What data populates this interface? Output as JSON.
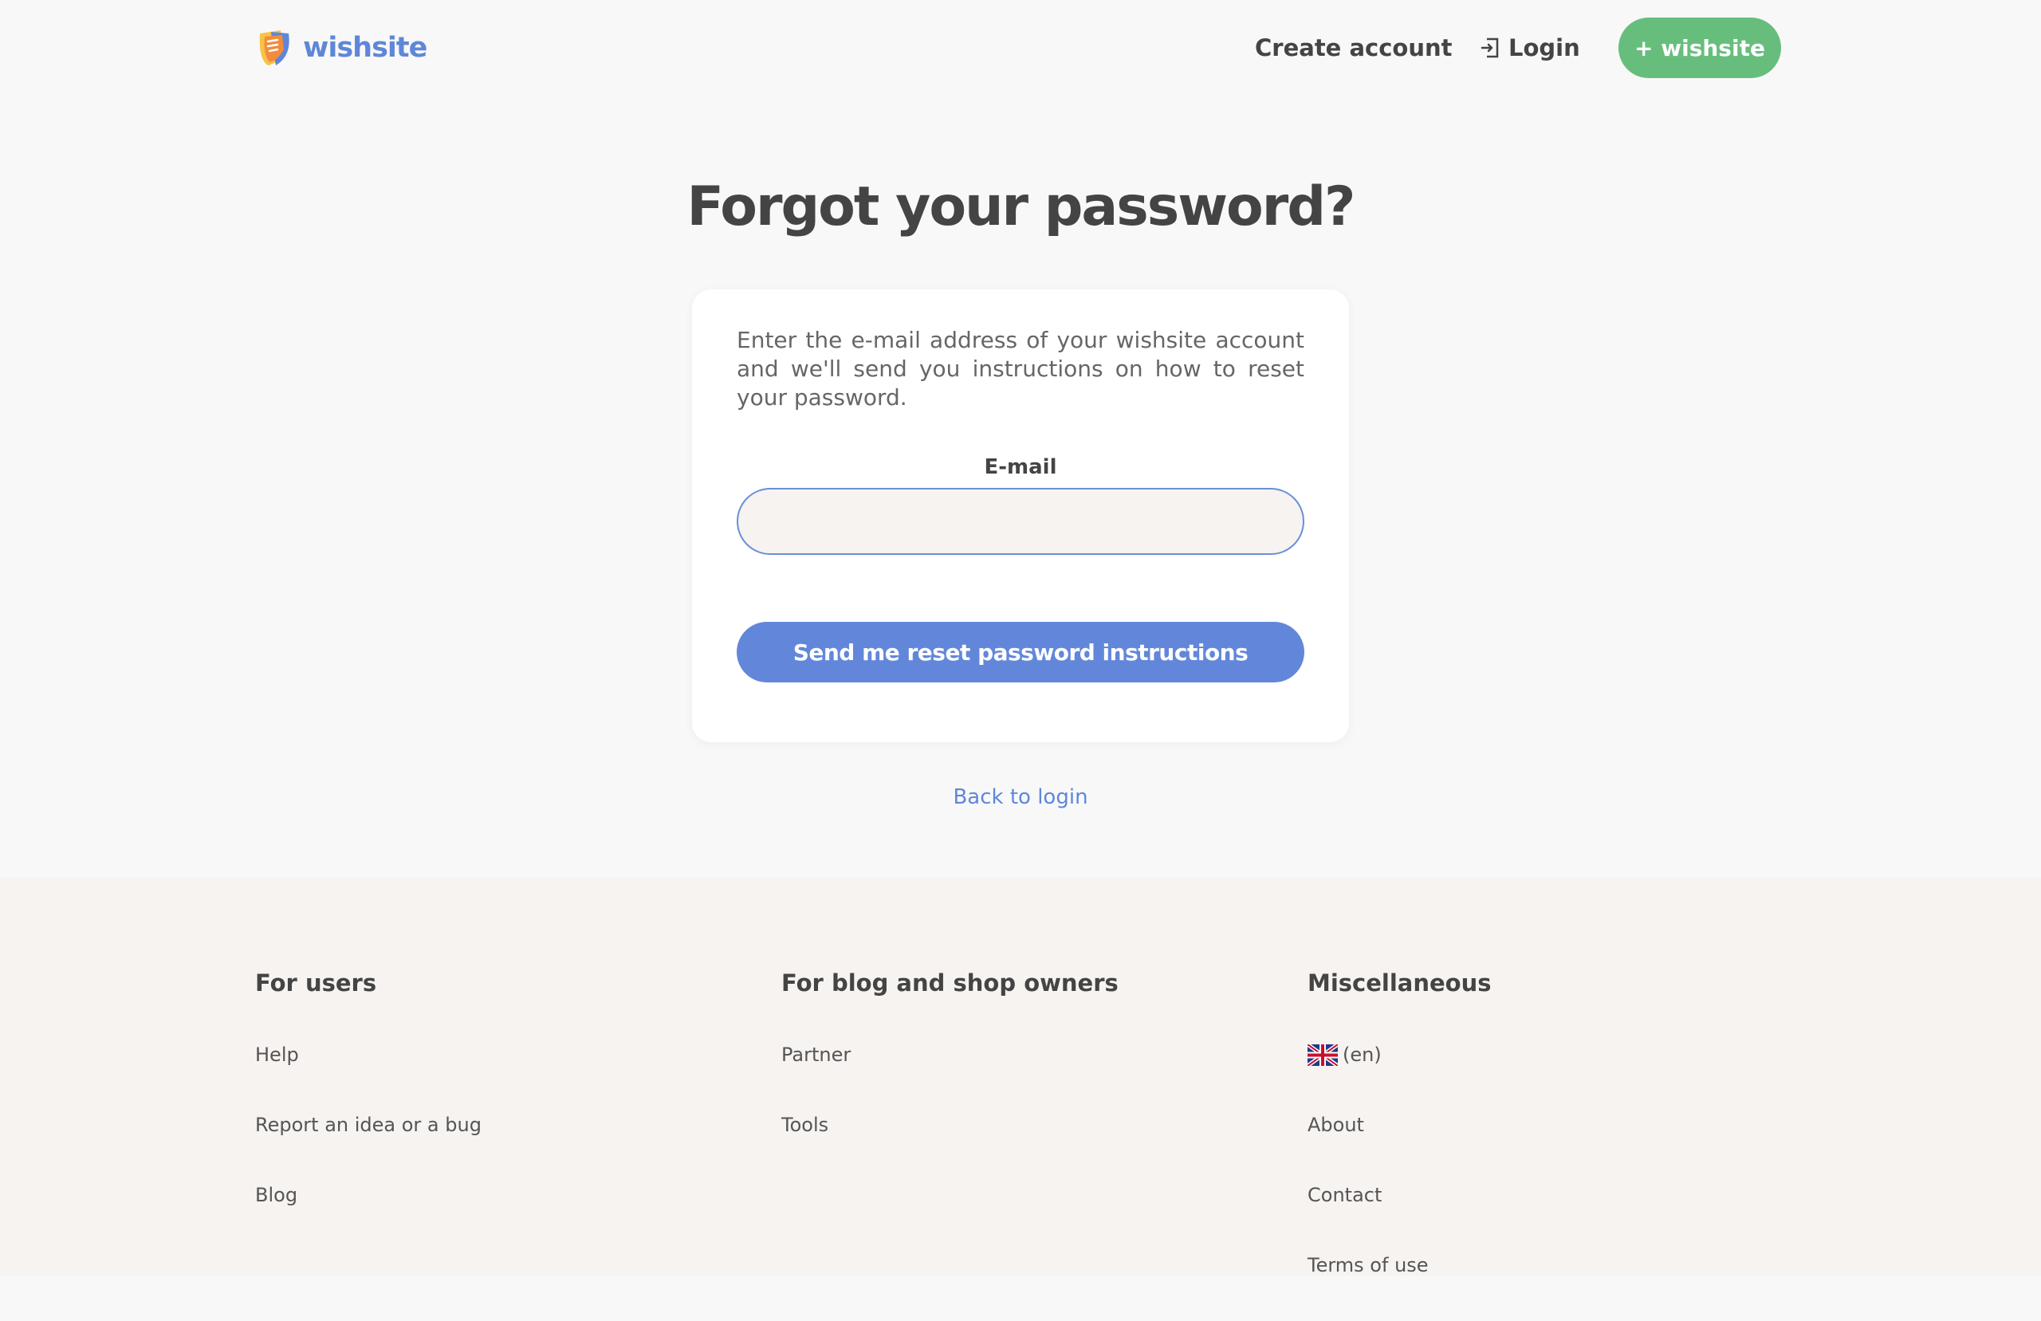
{
  "header": {
    "logo_text": "wishsite",
    "create_account": "Create account",
    "login": "Login",
    "cta": "+ wishsite"
  },
  "main": {
    "title": "Forgot your password?",
    "description": "Enter the e-mail address of your wishsite account and we'll send you instructions on how to reset your password.",
    "email_label": "E-mail",
    "email_value": "",
    "email_placeholder": "",
    "submit_label": "Send me reset password instructions",
    "back_link": "Back to login"
  },
  "footer": {
    "columns": [
      {
        "heading": "For users",
        "links": [
          "Help",
          "Report an idea or a bug",
          "Blog"
        ]
      },
      {
        "heading": "For blog and shop owners",
        "links": [
          "Partner",
          "Tools"
        ]
      },
      {
        "heading": "Miscellaneous",
        "language": "(en)",
        "links": [
          "About",
          "Contact",
          "Terms of use"
        ]
      }
    ]
  },
  "colors": {
    "brand_blue": "#5f87d8",
    "button_blue": "#6287da",
    "cta_green": "#67be7c",
    "footer_bg": "#f6f3f1"
  },
  "icons": {
    "logo": "wishsite-logo-icon",
    "login": "login-icon",
    "language": "uk-flag-icon"
  }
}
